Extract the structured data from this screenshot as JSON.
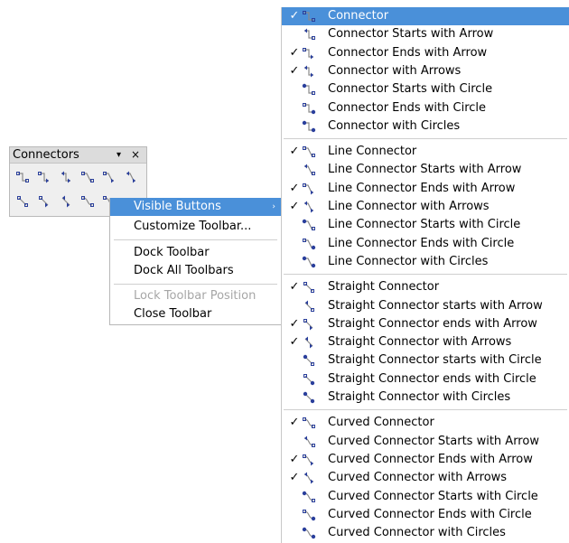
{
  "toolbar": {
    "title": "Connectors",
    "dropdown_glyph": "▾",
    "close_glyph": "×",
    "row1_icons": [
      "connector-icon",
      "connector-ends-arrow-icon",
      "connector-arrows-icon",
      "line-connector-icon",
      "line-connector-ends-arrow-icon",
      "line-connector-arrows-icon"
    ],
    "row2_icons": [
      "straight-connector-icon",
      "straight-connector-ends-arrow-icon",
      "straight-connector-arrows-icon",
      "curved-connector-icon",
      "curved-connector-partial-icon"
    ]
  },
  "context_menu": {
    "items": [
      {
        "label": "Visible Buttons",
        "submenu_glyph": "›"
      },
      {
        "label": "Customize Toolbar..."
      },
      {
        "label": "Dock Toolbar"
      },
      {
        "label": "Dock All Toolbars"
      },
      {
        "label": "Lock Toolbar Position",
        "disabled": true
      },
      {
        "label": "Close Toolbar"
      }
    ]
  },
  "submenu": {
    "check_glyph": "✓",
    "groups": [
      [
        {
          "label": "Connector",
          "checked": true,
          "icon": "connector-icon"
        },
        {
          "label": "Connector Starts with Arrow",
          "checked": false,
          "icon": "connector-starts-arrow-icon"
        },
        {
          "label": "Connector Ends with Arrow",
          "checked": true,
          "icon": "connector-ends-arrow-icon"
        },
        {
          "label": "Connector with Arrows",
          "checked": true,
          "icon": "connector-arrows-icon"
        },
        {
          "label": "Connector Starts with Circle",
          "checked": false,
          "icon": "connector-starts-circle-icon"
        },
        {
          "label": "Connector Ends with Circle",
          "checked": false,
          "icon": "connector-ends-circle-icon"
        },
        {
          "label": "Connector with Circles",
          "checked": false,
          "icon": "connector-circles-icon"
        }
      ],
      [
        {
          "label": "Line Connector",
          "checked": true,
          "icon": "line-connector-icon"
        },
        {
          "label": "Line Connector Starts with Arrow",
          "checked": false,
          "icon": "line-connector-starts-arrow-icon"
        },
        {
          "label": "Line Connector Ends with Arrow",
          "checked": true,
          "icon": "line-connector-ends-arrow-icon"
        },
        {
          "label": "Line Connector with Arrows",
          "checked": true,
          "icon": "line-connector-arrows-icon"
        },
        {
          "label": "Line Connector Starts with Circle",
          "checked": false,
          "icon": "line-connector-starts-circle-icon"
        },
        {
          "label": "Line Connector Ends with Circle",
          "checked": false,
          "icon": "line-connector-ends-circle-icon"
        },
        {
          "label": "Line Connector with Circles",
          "checked": false,
          "icon": "line-connector-circles-icon"
        }
      ],
      [
        {
          "label": "Straight Connector",
          "checked": true,
          "icon": "straight-connector-icon"
        },
        {
          "label": "Straight Connector starts with Arrow",
          "checked": false,
          "icon": "straight-connector-starts-arrow-icon"
        },
        {
          "label": "Straight Connector ends with Arrow",
          "checked": true,
          "icon": "straight-connector-ends-arrow-icon"
        },
        {
          "label": "Straight Connector with Arrows",
          "checked": true,
          "icon": "straight-connector-arrows-icon"
        },
        {
          "label": "Straight Connector starts with Circle",
          "checked": false,
          "icon": "straight-connector-starts-circle-icon"
        },
        {
          "label": "Straight Connector ends with Circle",
          "checked": false,
          "icon": "straight-connector-ends-circle-icon"
        },
        {
          "label": "Straight Connector with Circles",
          "checked": false,
          "icon": "straight-connector-circles-icon"
        }
      ],
      [
        {
          "label": "Curved Connector",
          "checked": true,
          "icon": "curved-connector-icon"
        },
        {
          "label": "Curved Connector Starts with Arrow",
          "checked": false,
          "icon": "curved-connector-starts-arrow-icon"
        },
        {
          "label": "Curved Connector Ends with Arrow",
          "checked": true,
          "icon": "curved-connector-ends-arrow-icon"
        },
        {
          "label": "Curved Connector with Arrows",
          "checked": true,
          "icon": "curved-connector-arrows-icon"
        },
        {
          "label": "Curved Connector Starts with Circle",
          "checked": false,
          "icon": "curved-connector-starts-circle-icon"
        },
        {
          "label": "Curved Connector Ends with Circle",
          "checked": false,
          "icon": "curved-connector-ends-circle-icon"
        },
        {
          "label": "Curved Connector with Circles",
          "checked": false,
          "icon": "curved-connector-circles-icon"
        }
      ]
    ]
  },
  "colors": {
    "highlight": "#4a90d9",
    "icon_blue": "#2a3f9c",
    "icon_gray": "#8a8a8a"
  }
}
